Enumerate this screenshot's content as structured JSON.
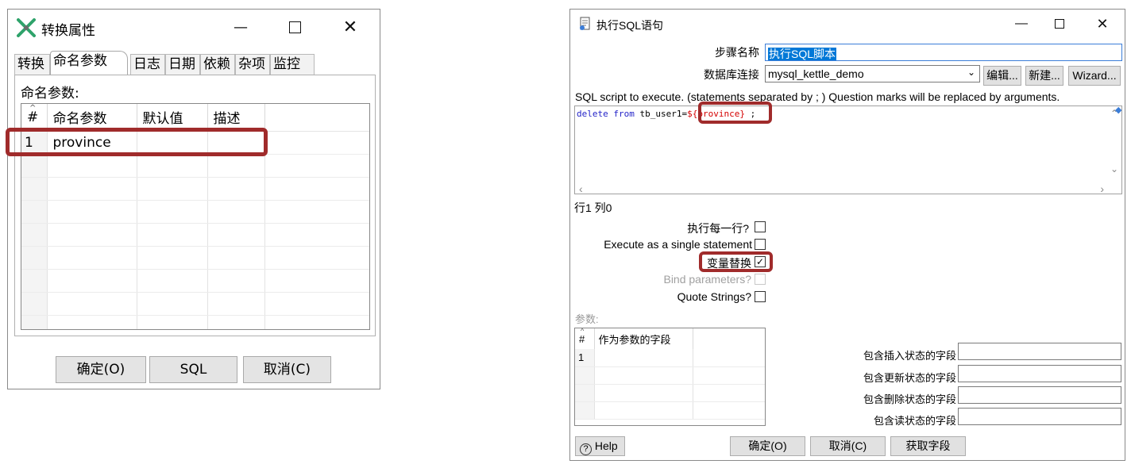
{
  "left_dialog": {
    "title": "转换属性",
    "tabs": [
      "转换",
      "命名参数",
      "日志",
      "日期",
      "依赖",
      "杂项",
      "监控"
    ],
    "active_tab": "命名参数",
    "panel_label": "命名参数:",
    "columns": [
      "#",
      "命名参数",
      "默认值",
      "描述"
    ],
    "rows": [
      {
        "num": "1",
        "name": "province",
        "default": "",
        "desc": ""
      }
    ],
    "buttons": {
      "ok": "确定(O)",
      "sql": "SQL",
      "cancel": "取消(C)"
    }
  },
  "right_dialog": {
    "title": "执行SQL语句",
    "step_name_label": "步骤名称",
    "step_name_value": "执行SQL脚本",
    "db_conn_label": "数据库连接",
    "db_conn_value": "mysql_kettle_demo",
    "db_buttons": {
      "edit": "编辑...",
      "new": "新建...",
      "wizard": "Wizard..."
    },
    "sql_hint": "SQL script to execute. (statements separated by ; ) Question marks will be replaced by arguments.",
    "sql": {
      "kw1": "delete",
      "kw2": "from",
      "table": " tb_user1=",
      "variable": "${province}",
      "tail": " ;"
    },
    "cursor_pos": "行1 列0",
    "options": [
      {
        "label": "执行每一行?",
        "checked": false,
        "enabled": true
      },
      {
        "label": "Execute as a single statement",
        "checked": false,
        "enabled": true
      },
      {
        "label": "变量替换",
        "checked": true,
        "enabled": true
      },
      {
        "label": "Bind parameters?",
        "checked": false,
        "enabled": false
      },
      {
        "label": "Quote Strings?",
        "checked": false,
        "enabled": true
      }
    ],
    "params_label": "参数:",
    "params_columns": [
      "#",
      "作为参数的字段"
    ],
    "params_rows": [
      {
        "num": "1",
        "field": ""
      }
    ],
    "status_fields": [
      {
        "label": "包含插入状态的字段",
        "value": ""
      },
      {
        "label": "包含更新状态的字段",
        "value": ""
      },
      {
        "label": "包含删除状态的字段",
        "value": ""
      },
      {
        "label": "包含读状态的字段",
        "value": ""
      }
    ],
    "buttons": {
      "help": "Help",
      "ok": "确定(O)",
      "cancel": "取消(C)",
      "get_fields": "获取字段"
    }
  },
  "colors": {
    "highlight": "#a02b2b",
    "selection": "#0078d7",
    "sql_keyword": "#2424c8",
    "sql_variable": "#d40000",
    "icon_green": "#2fa36b"
  }
}
